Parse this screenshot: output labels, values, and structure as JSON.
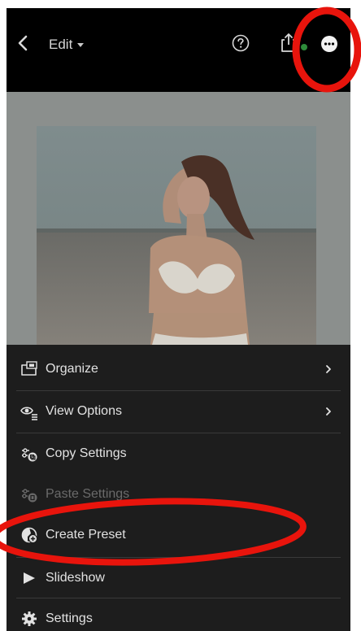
{
  "header": {
    "edit_label": "Edit",
    "icons": [
      "back-chevron-icon",
      "help-icon",
      "share-icon",
      "sync-icon",
      "more-options-icon"
    ]
  },
  "menu": {
    "items": [
      {
        "label": "Organize",
        "icon": "organize-icon",
        "has_submenu": true,
        "enabled": true
      },
      {
        "label": "View Options",
        "icon": "view-options-icon",
        "has_submenu": true,
        "enabled": true
      },
      {
        "label": "Copy Settings",
        "icon": "copy-settings-icon",
        "has_submenu": false,
        "enabled": true
      },
      {
        "label": "Paste Settings",
        "icon": "paste-settings-icon",
        "has_submenu": false,
        "enabled": false
      },
      {
        "label": "Create Preset",
        "icon": "create-preset-icon",
        "has_submenu": false,
        "enabled": true
      },
      {
        "label": "Slideshow",
        "icon": "play-icon",
        "has_submenu": false,
        "enabled": true
      },
      {
        "label": "Settings",
        "icon": "gear-icon",
        "has_submenu": false,
        "enabled": true
      }
    ]
  },
  "colors": {
    "background": "#000000",
    "menu_background": "#1d1d1d",
    "menu_text": "#e2e2e2",
    "disabled_text": "#6a6a6a",
    "annotation_red": "#e8140c",
    "sync_green": "#2e8b3a"
  }
}
